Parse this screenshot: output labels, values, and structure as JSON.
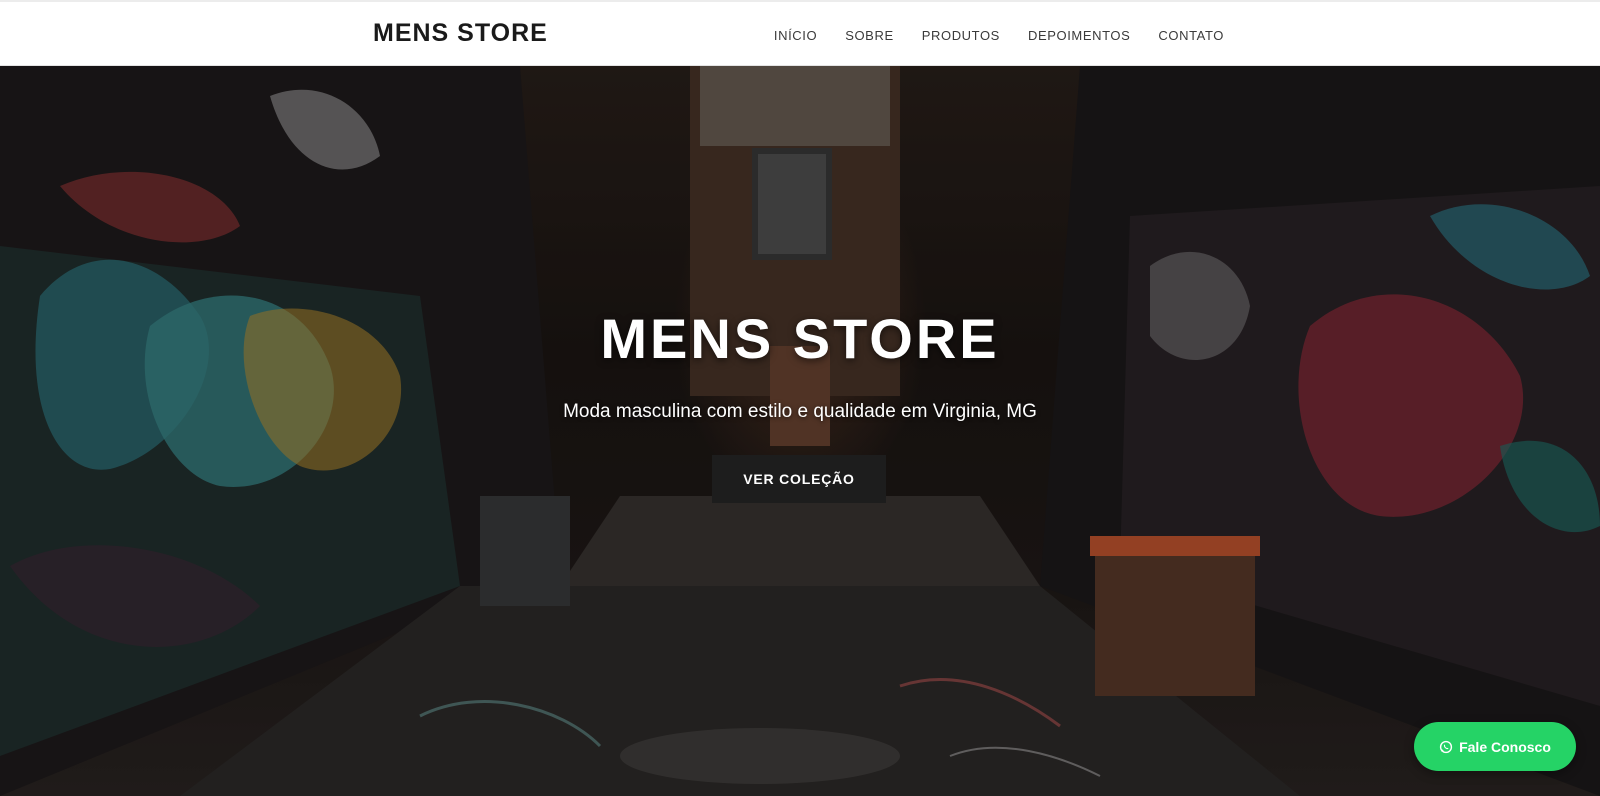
{
  "header": {
    "brand": "MENS STORE",
    "nav": [
      {
        "label": "INÍCIO"
      },
      {
        "label": "SOBRE"
      },
      {
        "label": "PRODUTOS"
      },
      {
        "label": "DEPOIMENTOS"
      },
      {
        "label": "CONTATO"
      }
    ]
  },
  "hero": {
    "title": "MENS STORE",
    "subtitle": "Moda masculina com estilo e qualidade em Virginia, MG",
    "cta_label": "VER COLEÇÃO",
    "background_image": "graffiti-alley-photo"
  },
  "floating": {
    "whatsapp_label": "Fale Conosco",
    "whatsapp_icon": "whatsapp-icon",
    "color": "#25d366"
  },
  "colors": {
    "nav_bg": "#ffffff",
    "brand_text": "#1a1a1a",
    "cta_bg": "#1d1d1d"
  }
}
